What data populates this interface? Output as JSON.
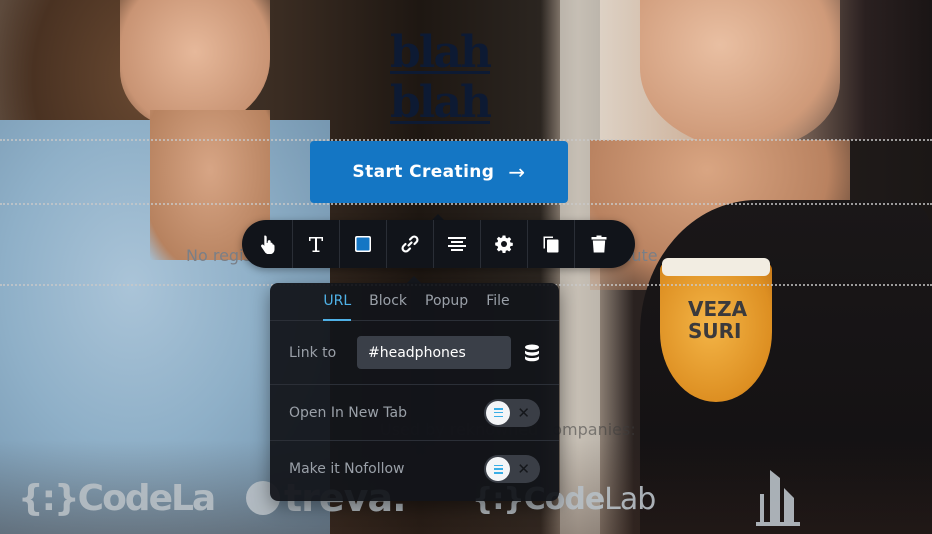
{
  "page": {
    "title": "blah blah",
    "cta_label": "Start Creating",
    "cta_arrow": "→",
    "subtext": "No registration required – get started in less than a minute",
    "social_proof": "Used by reknowned companies:",
    "logos": [
      {
        "name": "CodeLab",
        "text": "{:}CodeLa"
      },
      {
        "name": "treva",
        "text": "treva."
      },
      {
        "name": "CodeLab",
        "text_bold": "{:}Code",
        "text_light": "Lab"
      },
      {
        "name": "building-logo"
      }
    ],
    "photo_text": "VEZA SURI",
    "accent_color": "#1476c4"
  },
  "toolbar": {
    "tools": [
      {
        "name": "select",
        "icon": "hand-pointer-icon"
      },
      {
        "name": "text",
        "icon": "text-icon"
      },
      {
        "name": "color",
        "icon": "color-swatch-icon",
        "value": "#1476c4"
      },
      {
        "name": "link",
        "icon": "link-icon"
      },
      {
        "name": "align",
        "icon": "align-center-icon"
      },
      {
        "name": "settings",
        "icon": "gear-icon"
      },
      {
        "name": "duplicate",
        "icon": "copy-icon"
      },
      {
        "name": "delete",
        "icon": "trash-icon"
      }
    ]
  },
  "link_popover": {
    "tabs": [
      {
        "label": "URL",
        "active": true
      },
      {
        "label": "Block",
        "active": false
      },
      {
        "label": "Popup",
        "active": false
      },
      {
        "label": "File",
        "active": false
      }
    ],
    "link_to_label": "Link to",
    "link_value": "#headphones",
    "database_icon": "database-icon",
    "options": [
      {
        "label": "Open In New Tab",
        "enabled": false
      },
      {
        "label": "Make it Nofollow",
        "enabled": false
      }
    ],
    "accent_color": "#4fb1e6"
  }
}
